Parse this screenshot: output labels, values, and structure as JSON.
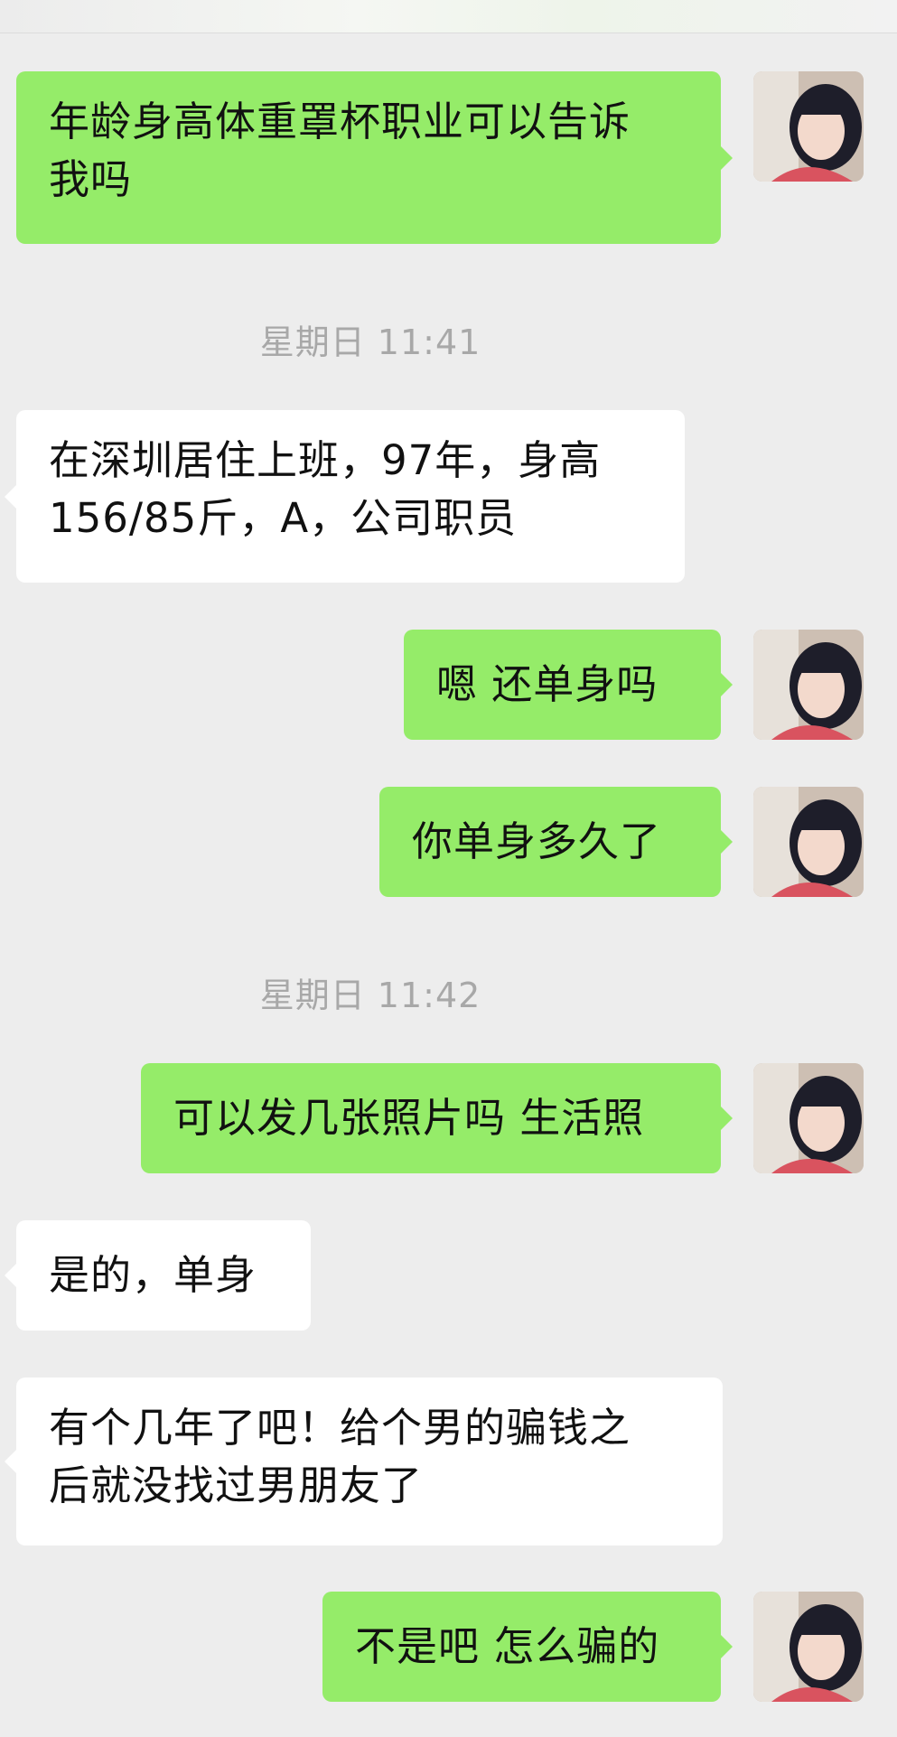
{
  "chat": {
    "messages": [
      {
        "side": "out",
        "text": "年龄身高体重罩杯职业可以告诉\n我吗"
      },
      {
        "type": "time",
        "text": "星期日 11:41"
      },
      {
        "side": "in",
        "text": "在深圳居住上班，97年，身高\n156/85斤，A，公司职员"
      },
      {
        "side": "out",
        "text": "嗯 还单身吗"
      },
      {
        "side": "out",
        "text": "你单身多久了"
      },
      {
        "type": "time",
        "text": "星期日 11:42"
      },
      {
        "side": "out",
        "text": "可以发几张照片吗 生活照"
      },
      {
        "side": "in",
        "text": "是的，单身"
      },
      {
        "side": "in",
        "text": "有个几年了吧！给个男的骗钱之\n后就没找过男朋友了"
      },
      {
        "side": "out",
        "text": "不是吧 怎么骗的"
      }
    ]
  },
  "colors": {
    "background": "#ededed",
    "outgoing_bubble": "#95ec69",
    "incoming_bubble": "#ffffff",
    "timestamp_text": "#a8a8a8"
  },
  "icons": {
    "avatar": "user-avatar-photo"
  }
}
